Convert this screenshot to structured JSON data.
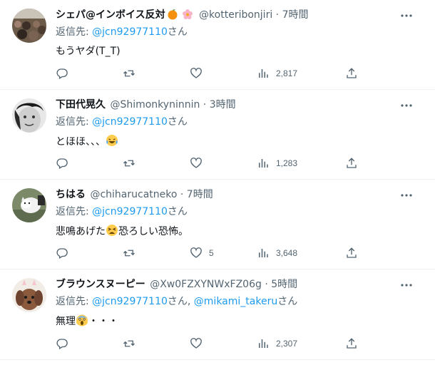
{
  "tweets": [
    {
      "name": "シェパ@インボイス反対",
      "handle": "@kotteribonjiri",
      "time": "7時間",
      "reply_prefix": "返信先: ",
      "reply_to": [
        "@jcn92977110"
      ],
      "reply_suffix": "さん",
      "text": "もうヤダ(T_T)",
      "stats": {
        "reply": "",
        "retweet": "",
        "like": "",
        "views": "2,817"
      }
    },
    {
      "name": "下田代晃久",
      "handle": "@Shimonkyninnin",
      "time": "3時間",
      "reply_prefix": "返信先: ",
      "reply_to": [
        "@jcn92977110"
      ],
      "reply_suffix": "さん",
      "text": "とほほ、、、",
      "stats": {
        "reply": "",
        "retweet": "",
        "like": "",
        "views": "1,283"
      }
    },
    {
      "name": "ちはる",
      "handle": "@chiharucatneko",
      "time": "7時間",
      "reply_prefix": "返信先: ",
      "reply_to": [
        "@jcn92977110"
      ],
      "reply_suffix": "さん",
      "text_a": "悲鳴あげた",
      "text_b": "恐ろしい恐怖。",
      "stats": {
        "reply": "",
        "retweet": "",
        "like": "5",
        "views": "3,648"
      }
    },
    {
      "name": "ブラウンスヌーピー",
      "handle": "@Xw0FZXYNWxFZ06g",
      "time": "5時間",
      "reply_prefix": "返信先: ",
      "reply_to": [
        "@jcn92977110",
        "@mikami_takeru"
      ],
      "reply_mid": "さん, ",
      "reply_suffix": "さん",
      "text_a": "無理",
      "text_b": "・・・",
      "stats": {
        "reply": "",
        "retweet": "",
        "like": "",
        "views": "2,307"
      }
    }
  ],
  "icons": [
    "reply-icon",
    "retweet-icon",
    "like-icon",
    "views-icon",
    "share-icon",
    "more-icon"
  ],
  "colors": {
    "text": "#0f1419",
    "secondary": "#536471",
    "link": "#1d9bf0",
    "border": "#eff3f4"
  }
}
